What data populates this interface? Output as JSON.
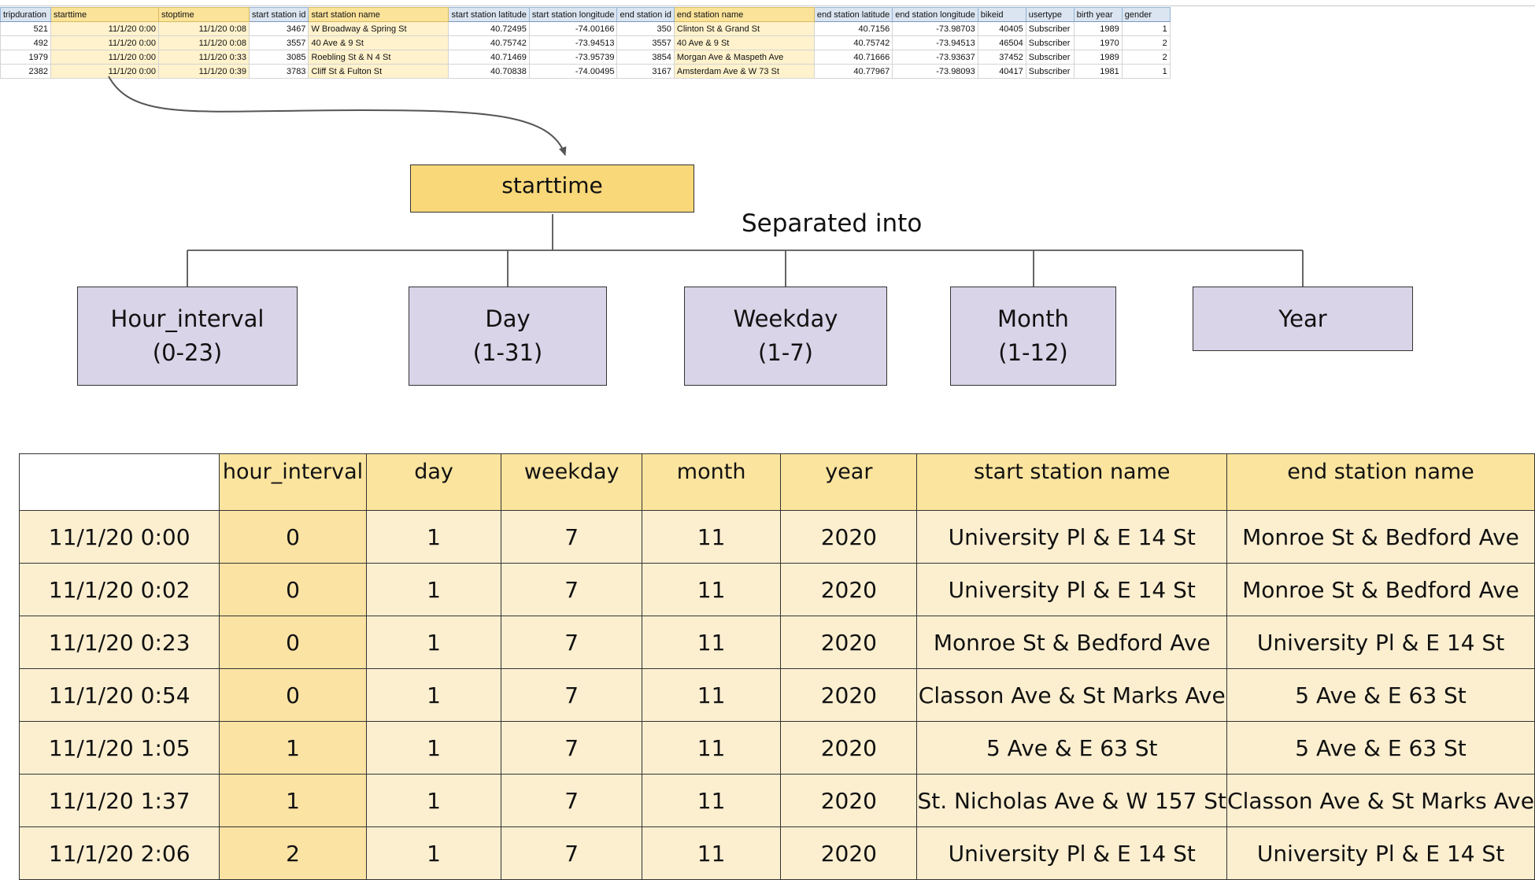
{
  "sheet": {
    "columns": [
      {
        "label": "tripduration",
        "hl": false
      },
      {
        "label": "starttime",
        "hl": true
      },
      {
        "label": "stoptime",
        "hl": true
      },
      {
        "label": "start station id",
        "hl": false
      },
      {
        "label": "start station name",
        "hl": true
      },
      {
        "label": "start station latitude",
        "hl": false
      },
      {
        "label": "start station longitude",
        "hl": false
      },
      {
        "label": "end station id",
        "hl": false
      },
      {
        "label": "end station name",
        "hl": true
      },
      {
        "label": "end station latitude",
        "hl": false
      },
      {
        "label": "end station longitude",
        "hl": false
      },
      {
        "label": "bikeid",
        "hl": false
      },
      {
        "label": "usertype",
        "hl": false
      },
      {
        "label": "birth year",
        "hl": false
      },
      {
        "label": "gender",
        "hl": false
      }
    ],
    "rows": [
      [
        "521",
        "11/1/20 0:00",
        "11/1/20 0:08",
        "3467",
        "W Broadway & Spring St",
        "40.72495",
        "-74.00166",
        "350",
        "Clinton St & Grand St",
        "40.7156",
        "-73.98703",
        "40405",
        "Subscriber",
        "1989",
        "1"
      ],
      [
        "492",
        "11/1/20 0:00",
        "11/1/20 0:08",
        "3557",
        "40 Ave & 9 St",
        "40.75742",
        "-73.94513",
        "3557",
        "40 Ave & 9 St",
        "40.75742",
        "-73.94513",
        "46504",
        "Subscriber",
        "1970",
        "2"
      ],
      [
        "1979",
        "11/1/20 0:00",
        "11/1/20 0:33",
        "3085",
        "Roebling St & N 4 St",
        "40.71469",
        "-73.95739",
        "3854",
        "Morgan Ave & Maspeth Ave",
        "40.71666",
        "-73.93637",
        "37452",
        "Subscriber",
        "1989",
        "2"
      ],
      [
        "2382",
        "11/1/20 0:00",
        "11/1/20 0:39",
        "3783",
        "Cliff St & Fulton St",
        "40.70838",
        "-74.00495",
        "3167",
        "Amsterdam Ave & W 73 St",
        "40.77967",
        "-73.98093",
        "40417",
        "Subscriber",
        "1981",
        "1"
      ]
    ]
  },
  "diagram": {
    "root": "starttime",
    "caption": "Separated into",
    "children": [
      {
        "name": "Hour_interval",
        "range": "(0-23)"
      },
      {
        "name": "Day",
        "range": "(1-31)"
      },
      {
        "name": "Weekday",
        "range": "(1-7)"
      },
      {
        "name": "Month",
        "range": "(1-12)"
      },
      {
        "name": "Year",
        "range": ""
      }
    ]
  },
  "result_table": {
    "headers": [
      "",
      "hour_interval",
      "day",
      "weekday",
      "month",
      "year",
      "start station name",
      "end station name"
    ],
    "rows": [
      [
        "11/1/20 0:00",
        "0",
        "1",
        "7",
        "11",
        "2020",
        "University Pl & E 14 St",
        "Monroe St & Bedford Ave"
      ],
      [
        "11/1/20 0:02",
        "0",
        "1",
        "7",
        "11",
        "2020",
        "University Pl & E 14 St",
        "Monroe St & Bedford Ave"
      ],
      [
        "11/1/20 0:23",
        "0",
        "1",
        "7",
        "11",
        "2020",
        "Monroe St & Bedford Ave",
        "University Pl & E 14 St"
      ],
      [
        "11/1/20 0:54",
        "0",
        "1",
        "7",
        "11",
        "2020",
        "Classon Ave & St Marks Ave",
        "5 Ave & E 63 St"
      ],
      [
        "11/1/20 1:05",
        "1",
        "1",
        "7",
        "11",
        "2020",
        "5 Ave & E 63 St",
        "5 Ave & E 63 St"
      ],
      [
        "11/1/20 1:37",
        "1",
        "1",
        "7",
        "11",
        "2020",
        "St. Nicholas Ave & W 157 St",
        "Classon Ave & St Marks Ave"
      ],
      [
        "11/1/20 2:06",
        "2",
        "1",
        "7",
        "11",
        "2020",
        "University Pl & E 14 St",
        "University Pl & E 14 St"
      ]
    ]
  }
}
